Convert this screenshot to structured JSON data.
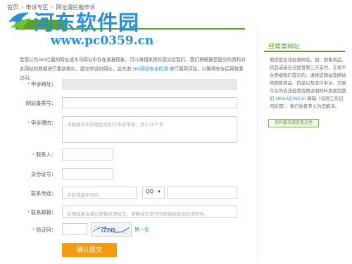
{
  "breadcrumb": {
    "item1": "首页",
    "sep": ">",
    "item2": "申诉专区",
    "item3": "网址谓拦截申诉"
  },
  "watermark": {
    "title": "河东软件园",
    "url": "www.pc0359.cn"
  },
  "intro": {
    "text_a": "若您认为360拦截的网址或木马网址中存在误报现象，可以将相关资料提交给我们，我们将根据您提交的资料对此网站的数据进行重新核实，提交申诉的网址，会先由 ",
    "link": "360网站安全检测",
    "text_b": " 进行漏洞评估，以确保安全后再恢复访问。"
  },
  "form": {
    "url_label": "申诉网址：",
    "record_label": "网站备案号：",
    "reason_label": "申诉理由：",
    "reason_placeholder": "详细填写申诉理由有利于申诉审核，至少20个字",
    "contact_label": "联系人：",
    "id_label": "身份证号：",
    "im_label": "联系电话：",
    "im_placeholder": "手机或座机号码",
    "im_type": "QQ",
    "email_label": "联系邮箱：",
    "email_placeholder": "处理结果会通过邮箱反馈给您，请确保您填写的邮箱能收到反馈邮件。",
    "captcha_label": "验证码：",
    "captcha_text": "dzn",
    "refresh_label": "换一张",
    "submit_label": "确认提交"
  },
  "sidebar": {
    "title": "经营类网址",
    "text_a": "若您是合法经营网站，如：销售商品、药品或者合法经营第三方支付、交易平台等被我们提示的，请将您网站及网站所销售商品、药品以及支付平台、交易平台的合法经营资质证明材料发送到我们 ",
    "email": "360url@360.cn",
    "text_b": " 邮箱（仅限工作日内处理），我们会有专人为您解决。",
    "button": "资料要求请查看这里"
  },
  "colors": {
    "accent_green": "#5aa02c",
    "link_blue": "#2a8fd8",
    "submit_orange": "#f39c12",
    "required_red": "#e64c2e"
  }
}
